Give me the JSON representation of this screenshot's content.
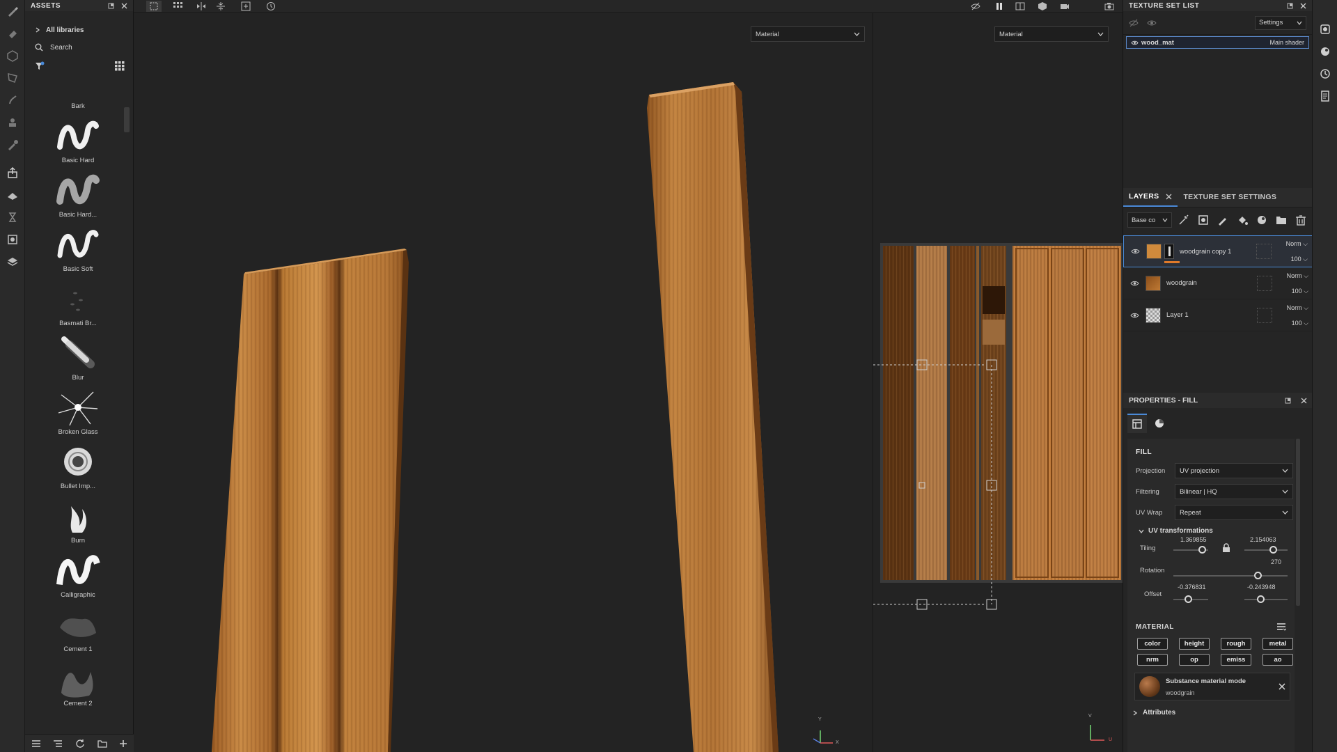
{
  "assets": {
    "title": "ASSETS",
    "library": "All libraries",
    "search_placeholder": "Search",
    "brushes": [
      {
        "label": "Bark",
        "icon": "bark-brush-icon"
      },
      {
        "label": "Basic Hard",
        "icon": "basic-hard-brush-icon"
      },
      {
        "label": "Basic Hard...",
        "icon": "basic-hard-soft-brush-icon"
      },
      {
        "label": "Basic Soft",
        "icon": "basic-soft-brush-icon"
      },
      {
        "label": "Basmati Br...",
        "icon": "basmati-brush-icon"
      },
      {
        "label": "Blur",
        "icon": "blur-brush-icon"
      },
      {
        "label": "Broken Glass",
        "icon": "broken-glass-brush-icon"
      },
      {
        "label": "Bullet Imp...",
        "icon": "bullet-impact-brush-icon"
      },
      {
        "label": "Burn",
        "icon": "burn-brush-icon"
      },
      {
        "label": "Calligraphic",
        "icon": "calligraphic-brush-icon"
      },
      {
        "label": "Cement 1",
        "icon": "cement-1-brush-icon"
      },
      {
        "label": "Cement 2",
        "icon": "cement-2-brush-icon"
      }
    ]
  },
  "viewport": {
    "left_material_mode": "Material",
    "right_material_mode": "Material",
    "axis_labels": {
      "x": "X",
      "y": "Y",
      "u": "U",
      "v": "V"
    }
  },
  "texture_set_list": {
    "title": "TEXTURE SET LIST",
    "settings_label": "Settings",
    "item_name": "wood_mat",
    "item_shader": "Main shader"
  },
  "layers_panel": {
    "tab_layers": "LAYERS",
    "tab_texture_set_settings": "TEXTURE SET SETTINGS",
    "channel": "Base co",
    "layers": [
      {
        "name": "woodgrain copy 1",
        "blend": "Norm",
        "opacity": "100",
        "selected": true
      },
      {
        "name": "woodgrain",
        "blend": "Norm",
        "opacity": "100",
        "selected": false
      },
      {
        "name": "Layer 1",
        "blend": "Norm",
        "opacity": "100",
        "selected": false
      }
    ]
  },
  "properties": {
    "title": "PROPERTIES - FILL",
    "fill_section": "FILL",
    "projection_label": "Projection",
    "projection_value": "UV projection",
    "filtering_label": "Filtering",
    "filtering_value": "Bilinear | HQ",
    "uvwrap_label": "UV Wrap",
    "uvwrap_value": "Repeat",
    "uv_transformations": "UV transformations",
    "tiling_label": "Tiling",
    "tiling_u": "1.369855",
    "tiling_v": "2.154063",
    "rotation_label": "Rotation",
    "rotation_value": "270",
    "offset_label": "Offset",
    "offset_u": "-0.376831",
    "offset_v": "-0.243948",
    "material_section": "MATERIAL",
    "channels": [
      "color",
      "height",
      "rough",
      "metal",
      "nrm",
      "op",
      "emiss",
      "ao"
    ],
    "substance_mode_label": "Substance material mode",
    "substance_material": "woodgrain",
    "attributes_label": "Attributes"
  },
  "colors": {
    "accent": "#4a8ad8",
    "wood_light": "#c98a45",
    "wood_dark": "#6a3b16",
    "layer_fill_orange": "#e07a2a"
  }
}
